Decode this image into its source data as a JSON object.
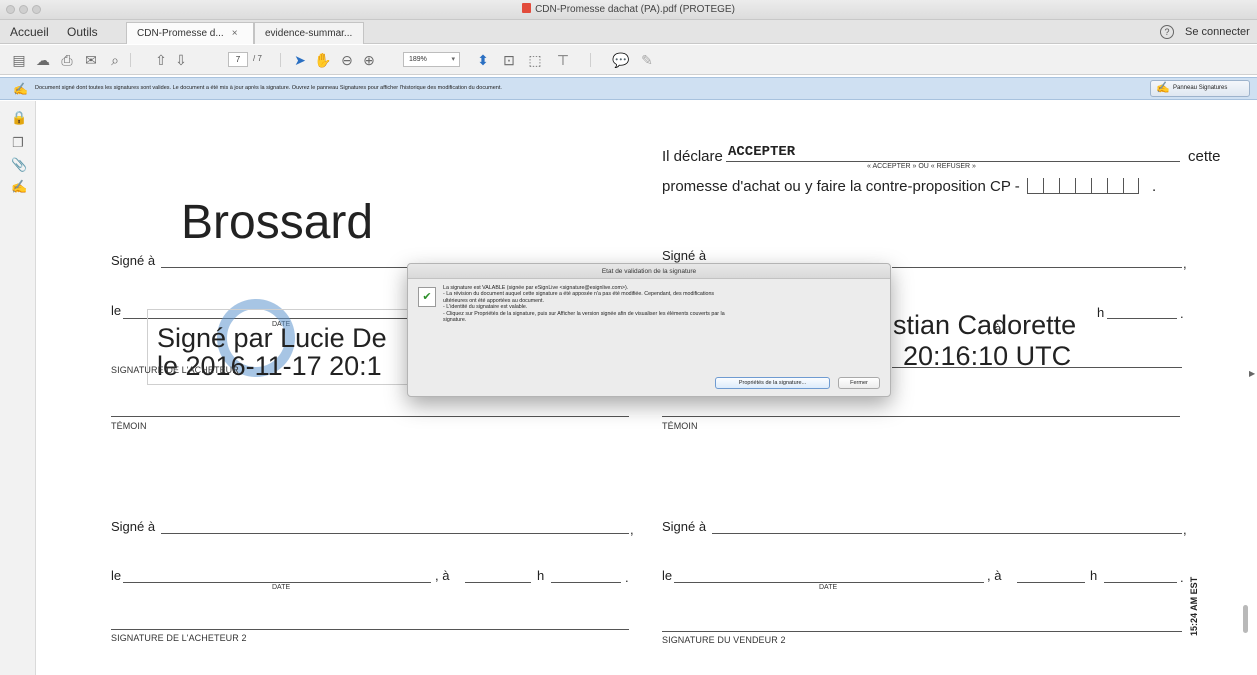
{
  "window": {
    "title": "CDN-Promesse dachat (PA).pdf (PROTEGE)"
  },
  "nav": {
    "home": "Accueil",
    "tools": "Outils",
    "tabs": [
      {
        "label": "CDN-Promesse d...",
        "close": "×"
      },
      {
        "label": "evidence-summar..."
      }
    ],
    "help_glyph": "?",
    "sign_in": "Se connecter"
  },
  "toolbar": {
    "page_current": "7",
    "page_total": "/ 7",
    "zoom": "189%"
  },
  "signature_banner": {
    "message": "Document signé dont toutes les signatures sont valides. Le document a été mis à jour après la signature. Ouvrez le panneau Signatures pour afficher l'historique des modification du document.",
    "panel_button": "Panneau Signatures"
  },
  "document": {
    "declare_prefix": "Il déclare",
    "accept_value": "ACCEPTER",
    "accept_hint": "« ACCEPTER » OU « REFUSER »",
    "cette": "cette",
    "promise_text": "promesse d'achat ou y faire la contre-proposition CP -",
    "period": ".",
    "stamp_name": "Brossard",
    "signe_a": "Signé à",
    "le": "le",
    "a": ", à",
    "h": "h",
    "date_label": "DATE",
    "comma": ",",
    "sig_name_left": "Signé par Lucie De",
    "sig_date_left": "le 2016-11-17 20:1",
    "sig_name_right": "stian Cadorette",
    "sig_date_right": "20:16:10 UTC",
    "sig_label_left": "SIGNATURE DE L'ACHETEUR",
    "temoin": "TÉMOIN",
    "sig_buyer2": "SIGNATURE DE L'ACHETEUR 2",
    "sig_seller2": "SIGNATURE DU VENDEUR 2",
    "timestamp": "15:24 AM EST"
  },
  "dialog": {
    "title": "Etat de validation de la signature",
    "lines": [
      "La signature est VALABLE (signée par eSignLive <signature@esignlive.com>).",
      "- La révision du document auquel cette signature a été apposée n'a pas été modifiée. Cependant, des modifications",
      "ultérieures ont été apportées au document.",
      "- L'identité du signataire est valable.",
      "- Cliquez sur Propriétés de la signature, puis sur Afficher la version signée afin de visualiser les éléments couverts par la",
      "signature."
    ],
    "properties_button": "Propriétés de la signature...",
    "close_button": "Fermer"
  }
}
